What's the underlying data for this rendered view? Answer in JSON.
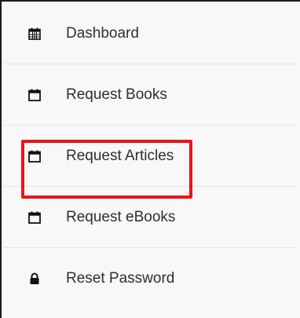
{
  "menu": {
    "items": [
      {
        "label": "Dashboard",
        "icon": "calendar-grid-icon"
      },
      {
        "label": "Request Books",
        "icon": "calendar-icon"
      },
      {
        "label": "Request Articles",
        "icon": "calendar-icon"
      },
      {
        "label": "Request eBooks",
        "icon": "calendar-icon"
      },
      {
        "label": "Reset Password",
        "icon": "lock-icon"
      }
    ]
  },
  "colors": {
    "highlight": "#e8141c",
    "text": "#2f2f2f",
    "background": "#f8f8f8",
    "divider": "#e2e2e2"
  }
}
